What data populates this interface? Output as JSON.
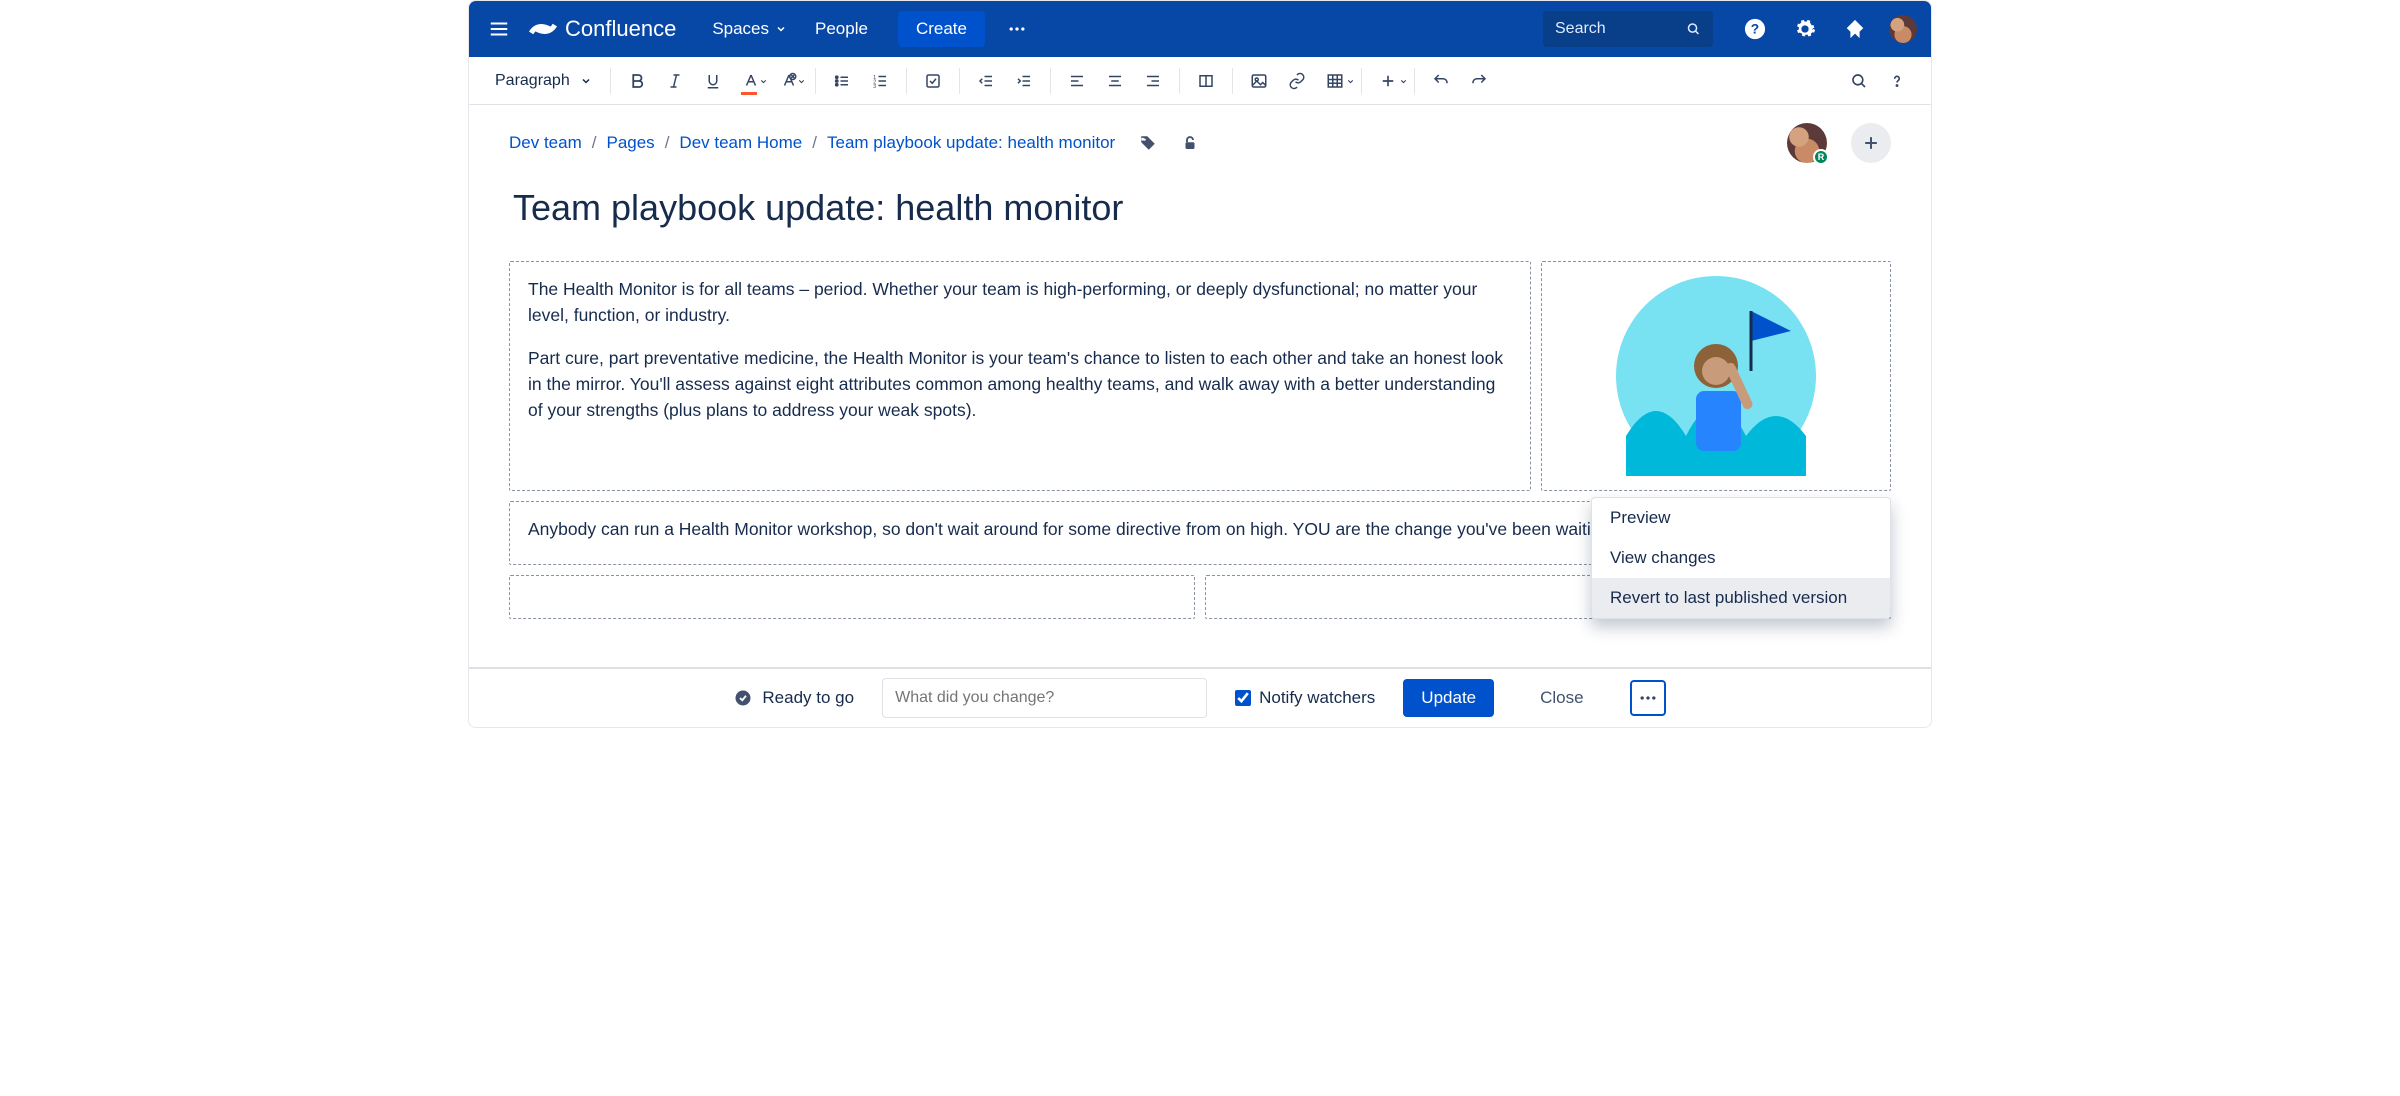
{
  "nav": {
    "brand": "Confluence",
    "items": {
      "spaces": "Spaces",
      "people": "People"
    },
    "create": "Create",
    "search_placeholder": "Search"
  },
  "toolbar": {
    "paragraph": "Paragraph"
  },
  "breadcrumbs": {
    "items": [
      "Dev team",
      "Pages",
      "Dev team Home",
      "Team playbook update: health monitor"
    ]
  },
  "page": {
    "title": "Team playbook update: health monitor",
    "p1": "The Health Monitor is for all teams – period. Whether your team is high-performing, or deeply dysfunctional; no matter your level, function, or industry.",
    "p2": "Part cure, part preventative medicine, the Health Monitor is your team's chance to listen to each other and take an honest look in the mirror. You'll assess against eight attributes common among healthy teams, and walk away with a better understanding of your strengths (plus plans to address your weak spots).",
    "p3": "Anybody can run a Health Monitor workshop, so don't wait around for some directive from on high. YOU are the change you've been waiting for."
  },
  "menu": {
    "preview": "Preview",
    "view_changes": "View changes",
    "revert": "Revert to last published version"
  },
  "footer": {
    "ready": "Ready to go",
    "change_placeholder": "What did you change?",
    "notify": "Notify watchers",
    "update": "Update",
    "close": "Close"
  },
  "presence_badge": "R"
}
